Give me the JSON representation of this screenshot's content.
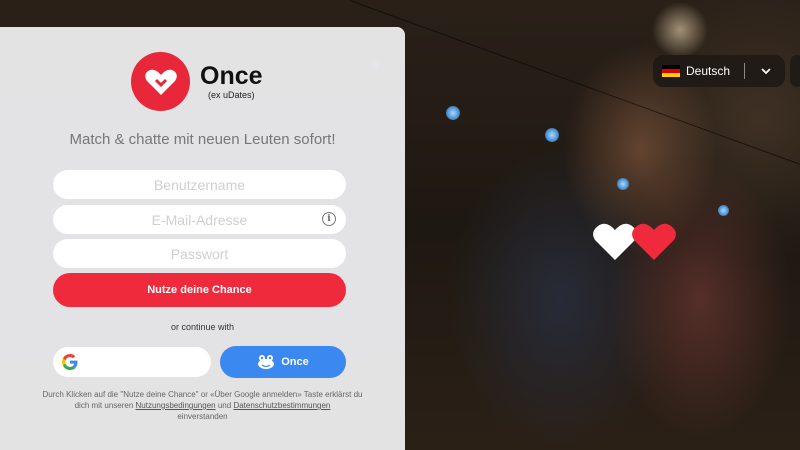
{
  "brand": {
    "name": "Once",
    "subtitle": "(ex uDates)",
    "color": "#e8283a"
  },
  "tagline": "Match & chatte mit neuen Leuten sofort!",
  "form": {
    "username_placeholder": "Benutzername",
    "email_placeholder": "E-Mail-Adresse",
    "password_placeholder": "Passwort",
    "submit_label": "Nutze deine Chance",
    "or_text": "or continue with",
    "google_icon": "google-icon",
    "once_label": "Once"
  },
  "legal": {
    "text_before": "Durch Klicken auf die \"Nutze deine Chance\" or «Über Google anmelden» Taste erklärst du dich mit unseren",
    "terms_link": "Nutzungsbedingungen",
    "and": "und",
    "privacy_link": "Datenschutzbestimmungen",
    "text_after": "einverstanden"
  },
  "language": {
    "label": "Deutsch",
    "flag": "german-flag-icon"
  },
  "colors": {
    "primary_button": "#ee2a3c",
    "once_button": "#3a88f0"
  }
}
